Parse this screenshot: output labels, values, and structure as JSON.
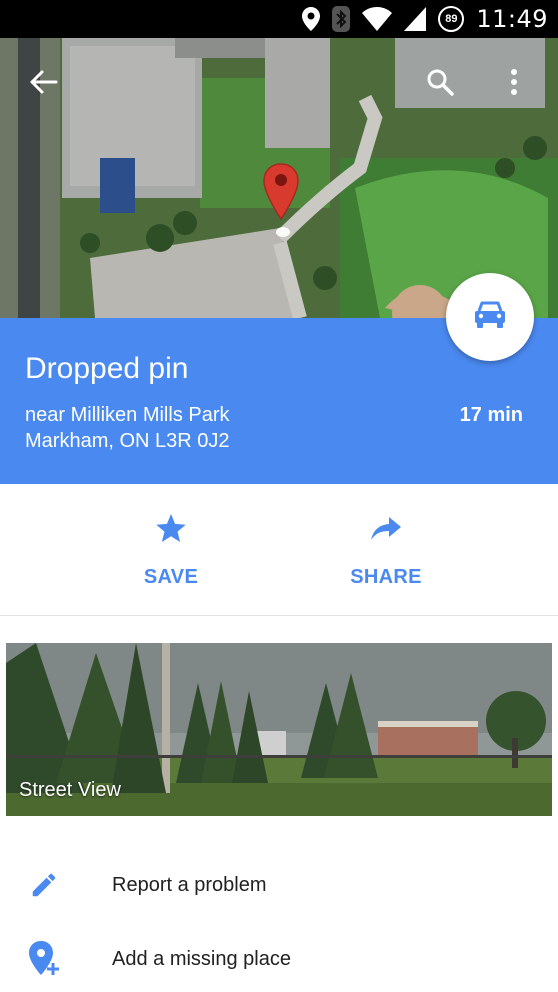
{
  "status_bar": {
    "time": "11:49",
    "battery_level": "89",
    "icons": [
      "location-icon",
      "bluetooth-icon",
      "wifi-icon",
      "signal-icon"
    ]
  },
  "map": {
    "back_icon": "arrow-back-icon",
    "search_icon": "search-icon",
    "more_icon": "more-vert-icon",
    "pin_icon": "map-pin-icon"
  },
  "place": {
    "title": "Dropped pin",
    "address_line1": "near Milliken Mills Park",
    "address_line2": "Markham, ON L3R 0J2",
    "eta": "17 min",
    "directions_icon": "car-icon"
  },
  "actions": {
    "save_label": "SAVE",
    "share_label": "SHARE"
  },
  "street_view": {
    "label": "Street View"
  },
  "list": {
    "report_label": "Report a problem",
    "add_place_label": "Add a missing place"
  },
  "colors": {
    "accent": "#4a89f0",
    "pin": "#d93a2e",
    "text_primary": "#212121"
  }
}
